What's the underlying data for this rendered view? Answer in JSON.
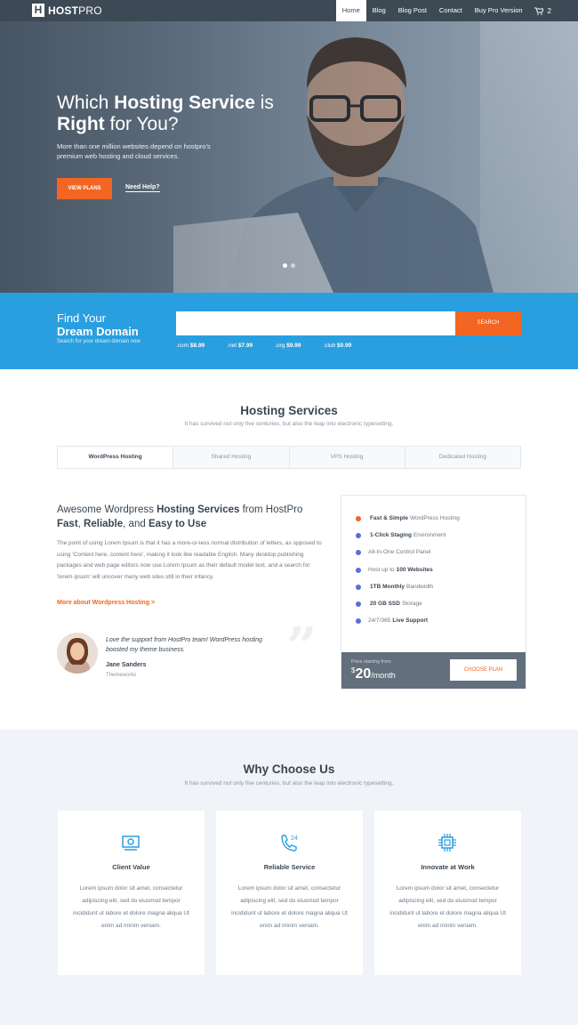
{
  "brand": {
    "name_bold": "HOST",
    "name_light": "PRO",
    "mark": "H"
  },
  "nav": {
    "items": [
      "Home",
      "Blog",
      "Blog Post",
      "Contact",
      "Buy Pro Version"
    ],
    "cart_count": "2"
  },
  "hero": {
    "title_part1": "Which ",
    "title_bold1": "Hosting Service",
    "title_part2": " is",
    "title_bold2": "Right",
    "title_part3": " for You?",
    "subtitle": "More than one million websites depend on hostpro's premium web hosting and cloud services.",
    "cta_primary": "VIEW PLANS",
    "cta_secondary": "Need Help?"
  },
  "domain": {
    "title_line1": "Find Your",
    "title_line2": "Dream Domain",
    "subtitle": "Search for your dream domain now",
    "search_placeholder": "",
    "search_button": "SEARCH",
    "tlds": [
      {
        "ext": ".com",
        "price": "$8.99"
      },
      {
        "ext": ".net",
        "price": "$7.99"
      },
      {
        "ext": ".org",
        "price": "$9.99"
      },
      {
        "ext": ".club",
        "price": "$0.99"
      }
    ]
  },
  "hosting": {
    "title": "Hosting Services",
    "subtitle": "It has survived not only five centuries, but also the leap into electronic typesetting.",
    "tabs": [
      "WordPress Hosting",
      "Shared Hosting",
      "VPS Hosting",
      "Dedicated Hosting"
    ],
    "heading_prefix": "Awesome Wordpress ",
    "heading_bold": "Hosting Services",
    "heading_suffix": " from HostPro",
    "heading_line2_b1": "Fast",
    "heading_line2_t1": ", ",
    "heading_line2_b2": "Reliable",
    "heading_line2_t2": ", and ",
    "heading_line2_b3": "Easy to Use",
    "body": "The point of using Lorem Ipsum is that it has a more-or-less normal distribution of letters, as opposed to using 'Content here, content here', making it look like readable English. Many desktop publishing packages and web page editors now use Lorem Ipsum as their default model text, and a search for 'lorem ipsum' will uncover many web sites still in their infancy.",
    "link": "More about Wordpress Hosting >",
    "testimonial": {
      "quote": "Love the support from HostPro team! WordPress hosting boosted my theme business.",
      "name": "Jane Sanders",
      "company": "Themeworks"
    },
    "plan": {
      "features": [
        {
          "pre": "",
          "bold": "Fast & Simple",
          "post": " WordPress Hosting",
          "color": "#f26522"
        },
        {
          "pre": "",
          "bold": "1-Click Staging",
          "post": " Environment",
          "color": "#5a6fd6"
        },
        {
          "pre": "All-In-One Control Panel",
          "bold": "",
          "post": "",
          "color": "#5a6fd6"
        },
        {
          "pre": "Host up to ",
          "bold": "100 Websites",
          "post": "",
          "color": "#5a6fd6"
        },
        {
          "pre": "",
          "bold": "1TB Monthly",
          "post": " Bandwidth",
          "color": "#5a6fd6"
        },
        {
          "pre": "",
          "bold": "20 GB SSD",
          "post": " Storage",
          "color": "#5a6fd6"
        },
        {
          "pre": "24/7/365 ",
          "bold": "Live Support",
          "post": "",
          "color": "#5a6fd6"
        }
      ],
      "price_label": "Price starting from",
      "currency": "$",
      "price": "20",
      "period": "/month",
      "button": "CHOOSE PLAN"
    }
  },
  "why": {
    "title": "Why Choose Us",
    "subtitle": "It has survived not only five centuries, but also the leap into electronic typesetting.",
    "cards": [
      {
        "title": "Client Value",
        "icon": "money-icon",
        "text": "Lorem ipsum dolor sit amet, consectetur adipiscing elit, sed do eiusmod tempor incididunt ut labore et dolore magna aliqua Ut enim ad minim veniam."
      },
      {
        "title": "Reliable Service",
        "icon": "phone-24-icon",
        "text": "Lorem ipsum dolor sit amet, consectetur adipiscing elit, sed do eiusmod tempor incididunt ut labore et dolore magna aliqua Ut enim ad minim veniam."
      },
      {
        "title": "Innovate at Work",
        "icon": "chip-icon",
        "text": "Lorem ipsum dolor sit amet, consectetur adipiscing elit, sed do eiusmod tempor incididunt ut labore et dolore magna aliqua Ut enim ad minim veniam."
      }
    ]
  },
  "colors": {
    "accent": "#f26522",
    "blue": "#2a9fe0",
    "nav": "#3d4a56"
  }
}
